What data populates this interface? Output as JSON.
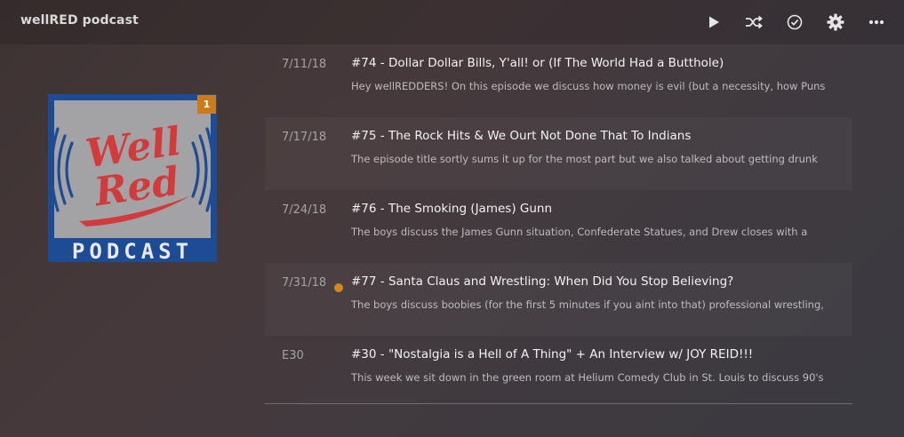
{
  "header": {
    "title": "wellRED podcast",
    "buttons": [
      {
        "name": "play-button",
        "icon": "play-icon"
      },
      {
        "name": "shuffle-button",
        "icon": "shuffle-icon"
      },
      {
        "name": "mark-played-button",
        "icon": "check-circle-icon"
      },
      {
        "name": "settings-button",
        "icon": "gear-icon"
      },
      {
        "name": "more-button",
        "icon": "more-icon"
      }
    ]
  },
  "poster": {
    "logo_text_line1": "Well",
    "logo_text_line2": "Red",
    "logo_word": "PODCAST",
    "unwatched_count": "1",
    "colors": {
      "border": "#1d4b94",
      "script": "#d23b3b",
      "waves": "#1d4b94",
      "badge": "#cc7b19"
    }
  },
  "episodes": [
    {
      "date": "7/11/18",
      "title": "#74 - Dollar Dollar Bills, Y'all! or (If The World Had a Butthole)",
      "summary": "Hey wellREDDERS! On this episode we discuss how money is evil (but a necessity, how Puns",
      "unplayed": false
    },
    {
      "date": "7/17/18",
      "title": "#75 - The Rock Hits & We Ourt Not Done That To Indians",
      "summary": "The episode title sortly sums it up for the most part but we also talked about getting drunk",
      "unplayed": false
    },
    {
      "date": "7/24/18",
      "title": "#76 - The Smoking (James) Gunn",
      "summary": "The boys discuss the James Gunn situation, Confederate Statues, and Drew closes with a",
      "unplayed": false
    },
    {
      "date": "7/31/18",
      "title": "#77 - Santa Claus and Wrestling: When Did You Stop Believing?",
      "summary": "The boys discuss boobies (for the first 5 minutes if you aint into that) professional wrestling,",
      "unplayed": true
    },
    {
      "date": "E30",
      "title": "#30 - \"Nostalgia is a Hell of A Thing\" + An Interview w/ JOY REID!!!",
      "summary": "This week we sit down in the green room at Helium Comedy Club in St. Louis to discuss 90's",
      "unplayed": false
    }
  ],
  "colors": {
    "accent": "#d8841e"
  }
}
